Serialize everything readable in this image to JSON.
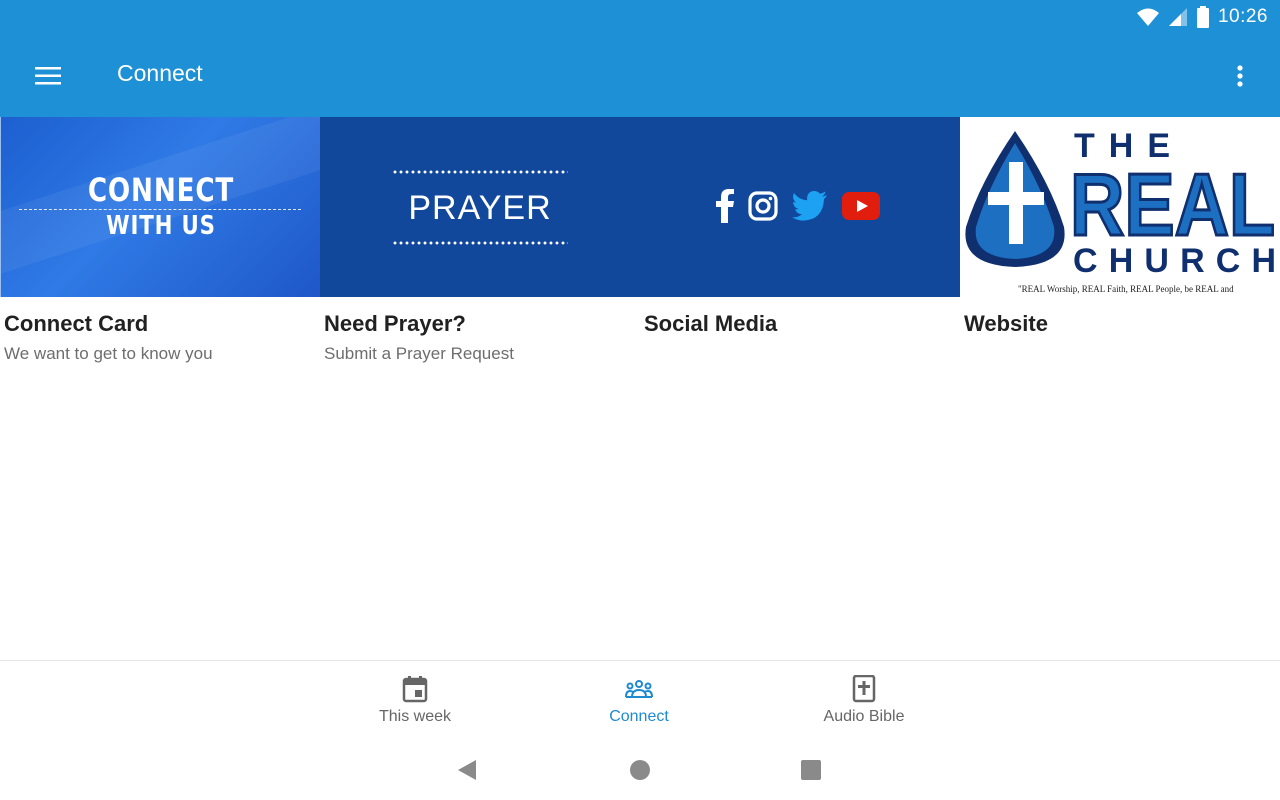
{
  "status_bar": {
    "time": "10:26"
  },
  "app_bar": {
    "title": "Connect"
  },
  "cards": [
    {
      "image_lines": [
        "CONNECT",
        "WITH US"
      ],
      "title": "Connect Card",
      "subtitle": "We want to get to know you"
    },
    {
      "image_lines": [
        "PRAYER"
      ],
      "title": "Need Prayer?",
      "subtitle": "Submit a Prayer Request"
    },
    {
      "image_icons": [
        "facebook-icon",
        "instagram-icon",
        "twitter-icon",
        "youtube-icon"
      ],
      "title": "Social Media",
      "subtitle": ""
    },
    {
      "image_lines": [
        "THE",
        "REAL",
        "CHURCH"
      ],
      "image_tagline": "\"REAL Worship, REAL Faith, REAL People, be REAL and",
      "title": "Website",
      "subtitle": ""
    }
  ],
  "bottom_nav": {
    "items": [
      {
        "label": "This week",
        "icon": "calendar-icon",
        "active": false
      },
      {
        "label": "Connect",
        "icon": "people-icon",
        "active": true
      },
      {
        "label": "Audio Bible",
        "icon": "bible-icon",
        "active": false
      }
    ]
  },
  "colors": {
    "primary": "#1e90d6",
    "active_nav": "#1e8ad0",
    "card_dark_blue": "#12489b",
    "logo_navy": "#0f2f6e",
    "logo_blue": "#1d6fc2"
  }
}
